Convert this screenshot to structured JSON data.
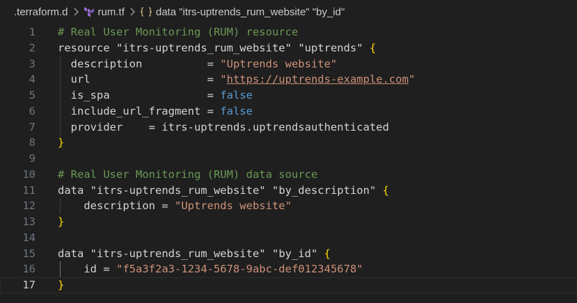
{
  "breadcrumb": {
    "folder": ".terraform.d",
    "file": "rum.tf",
    "symbol": "data \"itrs-uptrends_rum_website\" \"by_id\""
  },
  "editor": {
    "lines": [
      {
        "n": "1",
        "tokens": [
          {
            "t": "# Real User Monitoring (RUM) resource",
            "c": "comment"
          }
        ]
      },
      {
        "n": "2",
        "tokens": [
          {
            "t": "resource ",
            "c": "kw"
          },
          {
            "t": "\"itrs-uptrends_rum_website\"",
            "c": "kw"
          },
          {
            "t": " ",
            "c": "plain"
          },
          {
            "t": "\"uptrends\"",
            "c": "kw"
          },
          {
            "t": " ",
            "c": "plain"
          },
          {
            "t": "{",
            "c": "brace"
          }
        ]
      },
      {
        "n": "3",
        "tokens": [
          {
            "t": "  description          = ",
            "c": "plain"
          },
          {
            "t": "\"Uptrends website\"",
            "c": "str"
          }
        ]
      },
      {
        "n": "4",
        "tokens": [
          {
            "t": "  url                  = ",
            "c": "plain"
          },
          {
            "t": "\"",
            "c": "str"
          },
          {
            "t": "https://uptrends-example.com",
            "c": "link"
          },
          {
            "t": "\"",
            "c": "str"
          }
        ]
      },
      {
        "n": "5",
        "tokens": [
          {
            "t": "  is_spa               = ",
            "c": "plain"
          },
          {
            "t": "false",
            "c": "const"
          }
        ]
      },
      {
        "n": "6",
        "tokens": [
          {
            "t": "  include_url_fragment = ",
            "c": "plain"
          },
          {
            "t": "false",
            "c": "const"
          }
        ]
      },
      {
        "n": "7",
        "tokens": [
          {
            "t": "  provider    = itrs-uptrends.uptrendsauthenticated",
            "c": "plain"
          }
        ]
      },
      {
        "n": "8",
        "tokens": [
          {
            "t": "}",
            "c": "brace"
          }
        ]
      },
      {
        "n": "9",
        "tokens": []
      },
      {
        "n": "10",
        "tokens": [
          {
            "t": "# Real User Monitoring (RUM) data source",
            "c": "comment"
          }
        ]
      },
      {
        "n": "11",
        "tokens": [
          {
            "t": "data ",
            "c": "kw"
          },
          {
            "t": "\"itrs-uptrends_rum_website\"",
            "c": "kw"
          },
          {
            "t": " ",
            "c": "plain"
          },
          {
            "t": "\"by_description\"",
            "c": "kw"
          },
          {
            "t": " ",
            "c": "plain"
          },
          {
            "t": "{",
            "c": "brace"
          }
        ]
      },
      {
        "n": "12",
        "tokens": [
          {
            "t": "    description = ",
            "c": "plain"
          },
          {
            "t": "\"Uptrends website\"",
            "c": "str"
          }
        ]
      },
      {
        "n": "13",
        "tokens": [
          {
            "t": "}",
            "c": "brace"
          }
        ]
      },
      {
        "n": "14",
        "tokens": []
      },
      {
        "n": "15",
        "tokens": [
          {
            "t": "data ",
            "c": "kw"
          },
          {
            "t": "\"itrs-uptrends_rum_website\"",
            "c": "kw"
          },
          {
            "t": " ",
            "c": "plain"
          },
          {
            "t": "\"by_id\"",
            "c": "kw"
          },
          {
            "t": " ",
            "c": "plain"
          },
          {
            "t": "{",
            "c": "brace"
          }
        ]
      },
      {
        "n": "16",
        "tokens": [
          {
            "t": "    id = ",
            "c": "plain"
          },
          {
            "t": "\"f5a3f2a3-1234-5678-9abc-def012345678\"",
            "c": "str"
          }
        ]
      },
      {
        "n": "17",
        "tokens": [
          {
            "t": "}",
            "c": "brace"
          }
        ]
      }
    ],
    "current_line": "17"
  },
  "colors": {
    "background": "#1f1f1f",
    "comment": "#6a9955",
    "string": "#ce9178",
    "constant": "#569cd6",
    "brace": "#ffd700",
    "line_number": "#6e7681"
  },
  "icons": {
    "separator": "chevron-right-icon",
    "file": "terraform-icon",
    "symbol": "symbol-namespace-icon"
  }
}
